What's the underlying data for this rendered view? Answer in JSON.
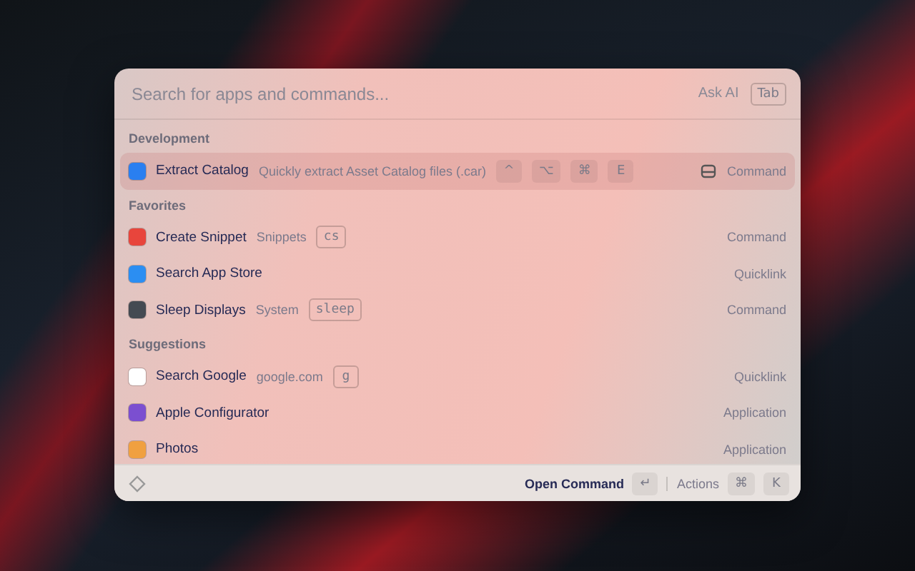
{
  "search": {
    "placeholder": "Search for apps and commands...",
    "ask_ai": "Ask AI",
    "ask_ai_key": "Tab"
  },
  "sections": [
    {
      "title": "Development",
      "items": [
        {
          "title": "Extract Catalog",
          "subtitle": "Quickly extract Asset Catalog files (.car)",
          "keys": [
            "^",
            "⌥",
            "⌘",
            "E"
          ],
          "type": "Command",
          "color": "#2a7ff0",
          "selected": true
        }
      ]
    },
    {
      "title": "Favorites",
      "items": [
        {
          "title": "Create Snippet",
          "subtitle": "Snippets",
          "tag": "cs",
          "type": "Command",
          "color": "#e8453c",
          "selected": false
        },
        {
          "title": "Search App Store",
          "type": "Quicklink",
          "color": "#2b8ef2",
          "selected": false
        },
        {
          "title": "Sleep Displays",
          "subtitle": "System",
          "tag": "sleep",
          "type": "Command",
          "color": "#444a52",
          "selected": false
        }
      ]
    },
    {
      "title": "Suggestions",
      "items": [
        {
          "title": "Search Google",
          "subtitle": "google.com",
          "tag": "g",
          "type": "Quicklink",
          "color": "#ffffff",
          "selected": false
        },
        {
          "title": "Apple Configurator",
          "type": "Application",
          "color": "#7b4fd0",
          "selected": false
        },
        {
          "title": "Photos",
          "type": "Application",
          "color": "#f0a040",
          "selected": false
        }
      ]
    }
  ],
  "footer": {
    "primary": "Open Command",
    "primary_key": "↵",
    "actions": "Actions",
    "actions_keys": [
      "⌘",
      "K"
    ]
  }
}
